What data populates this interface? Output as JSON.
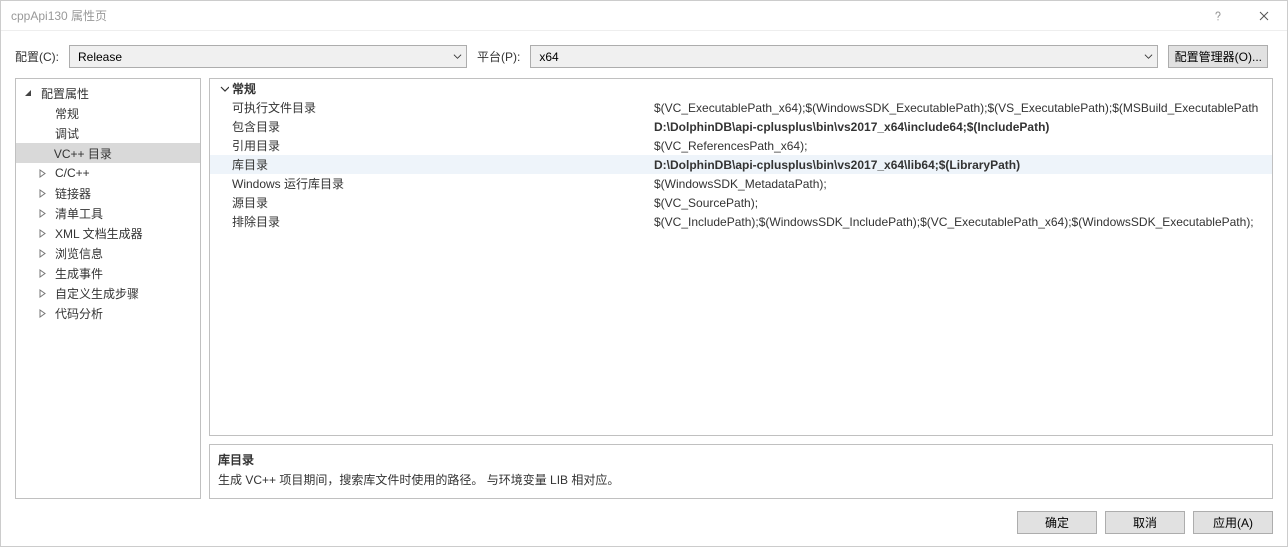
{
  "window": {
    "title": "cppApi130 属性页"
  },
  "toolbar": {
    "config_label": "配置(C):",
    "config_value": "Release",
    "platform_label": "平台(P):",
    "platform_value": "x64",
    "manager_label": "配置管理器(O)..."
  },
  "tree": {
    "root_label": "配置属性",
    "items": [
      {
        "label": "常规",
        "expandable": false
      },
      {
        "label": "调试",
        "expandable": false
      },
      {
        "label": "VC++ 目录",
        "expandable": false,
        "selected": true
      },
      {
        "label": "C/C++",
        "expandable": true
      },
      {
        "label": "链接器",
        "expandable": true
      },
      {
        "label": "清单工具",
        "expandable": true
      },
      {
        "label": "XML 文档生成器",
        "expandable": true
      },
      {
        "label": "浏览信息",
        "expandable": true
      },
      {
        "label": "生成事件",
        "expandable": true
      },
      {
        "label": "自定义生成步骤",
        "expandable": true
      },
      {
        "label": "代码分析",
        "expandable": true
      }
    ]
  },
  "propgrid": {
    "category": "常规",
    "rows": [
      {
        "label": "可执行文件目录",
        "value": "$(VC_ExecutablePath_x64);$(WindowsSDK_ExecutablePath);$(VS_ExecutablePath);$(MSBuild_ExecutablePath",
        "bold": false
      },
      {
        "label": "包含目录",
        "value": "D:\\DolphinDB\\api-cplusplus\\bin\\vs2017_x64\\include64;$(IncludePath)",
        "bold": true
      },
      {
        "label": "引用目录",
        "value": "$(VC_ReferencesPath_x64);",
        "bold": false
      },
      {
        "label": "库目录",
        "value": "D:\\DolphinDB\\api-cplusplus\\bin\\vs2017_x64\\lib64;$(LibraryPath)",
        "bold": true,
        "selected": true
      },
      {
        "label": "Windows 运行库目录",
        "value": "$(WindowsSDK_MetadataPath);",
        "bold": false
      },
      {
        "label": "源目录",
        "value": "$(VC_SourcePath);",
        "bold": false
      },
      {
        "label": "排除目录",
        "value": "$(VC_IncludePath);$(WindowsSDK_IncludePath);$(VC_ExecutablePath_x64);$(WindowsSDK_ExecutablePath);",
        "bold": false
      }
    ]
  },
  "help": {
    "title": "库目录",
    "text": "生成 VC++ 项目期间，搜索库文件时使用的路径。  与环境变量 LIB 相对应。"
  },
  "footer": {
    "ok": "确定",
    "cancel": "取消",
    "apply": "应用(A)"
  }
}
